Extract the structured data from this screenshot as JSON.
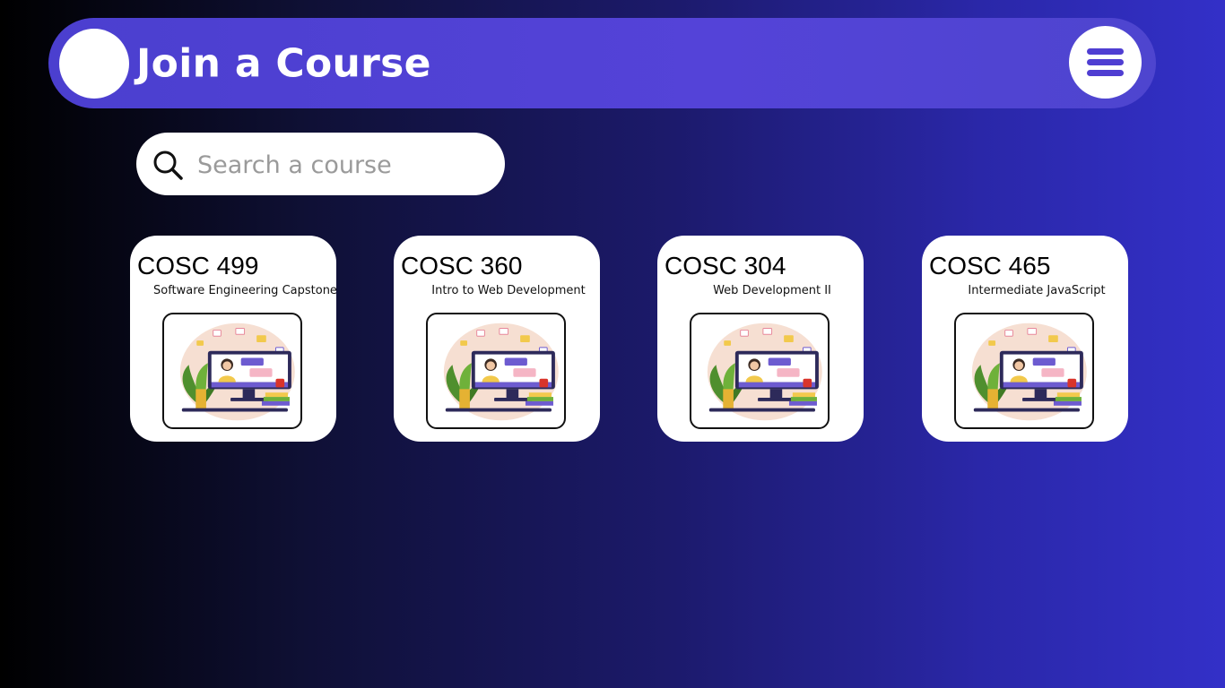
{
  "header": {
    "title": "Join a Course"
  },
  "search": {
    "placeholder": "Search a course",
    "value": ""
  },
  "courses": [
    {
      "code": "COSC 499",
      "name": "Software Engineering Capstone"
    },
    {
      "code": "COSC 360",
      "name": "Intro to Web Development"
    },
    {
      "code": "COSC 304",
      "name": "Web Development II"
    },
    {
      "code": "COSC 465",
      "name": "Intermediate JavaScript"
    }
  ],
  "colors": {
    "accent": "#4f3ed2",
    "header_bg": "#5443d8",
    "card_bg": "#ffffff"
  },
  "icons": {
    "menu": "hamburger-menu-icon",
    "search": "search-icon",
    "illustration": "online-learning-illustration"
  }
}
